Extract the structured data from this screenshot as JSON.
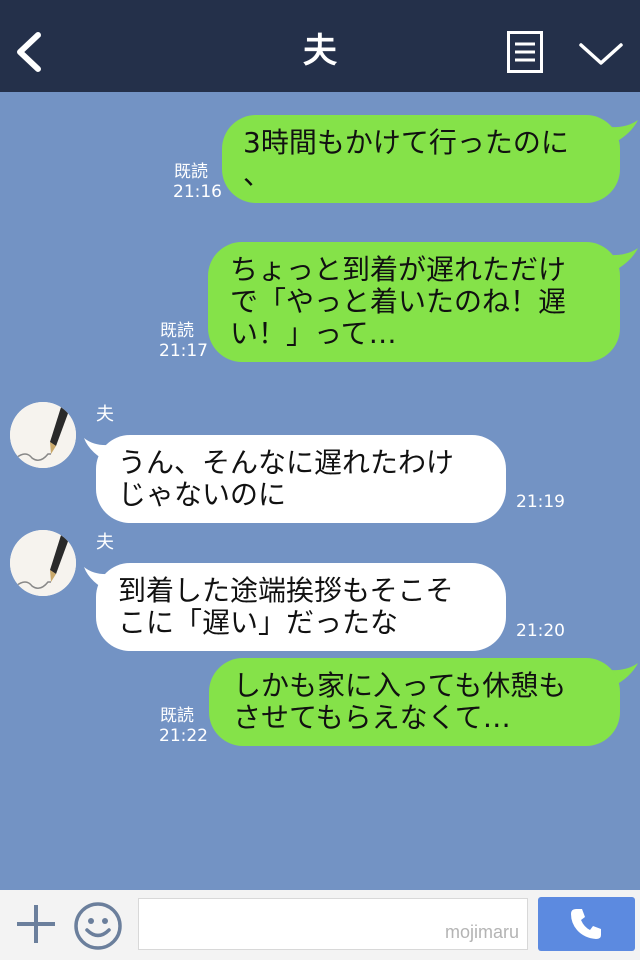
{
  "header": {
    "title": "夫",
    "icons": {
      "back": "back-chevron-icon",
      "menu": "menu-list-icon",
      "collapse": "chevron-down-icon"
    }
  },
  "messages": [
    {
      "direction": "outgoing",
      "lines": [
        "3時間もかけて行ったのに",
        "、"
      ],
      "read": "既読",
      "time": "21:16"
    },
    {
      "direction": "outgoing",
      "lines": [
        "ちょっと到着が遅れただけ",
        "で「やっと着いたのね！遅",
        "い！」って…"
      ],
      "read": "既読",
      "time": "21:17"
    },
    {
      "direction": "incoming",
      "sender": "夫",
      "lines": [
        "うん、そんなに遅れたわけ",
        "じゃないのに"
      ],
      "time": "21:19"
    },
    {
      "direction": "incoming",
      "sender": "夫",
      "lines": [
        "到着した途端挨拶もそこそ",
        "こに「遅い」だったな"
      ],
      "time": "21:20"
    },
    {
      "direction": "outgoing",
      "lines": [
        "しかも家に入っても休憩も",
        "させてもらえなくて…"
      ],
      "read": "既読",
      "time": "21:22"
    }
  ],
  "footer": {
    "watermark": "mojimaru",
    "icons": {
      "add": "plus-icon",
      "sticker": "smiley-icon",
      "call": "phone-icon"
    }
  },
  "colors": {
    "background": "#7393c4",
    "header": "#24304a",
    "outgoing_bubble": "#85e249",
    "incoming_bubble": "#ffffff",
    "call_button": "#5c8ae0"
  }
}
